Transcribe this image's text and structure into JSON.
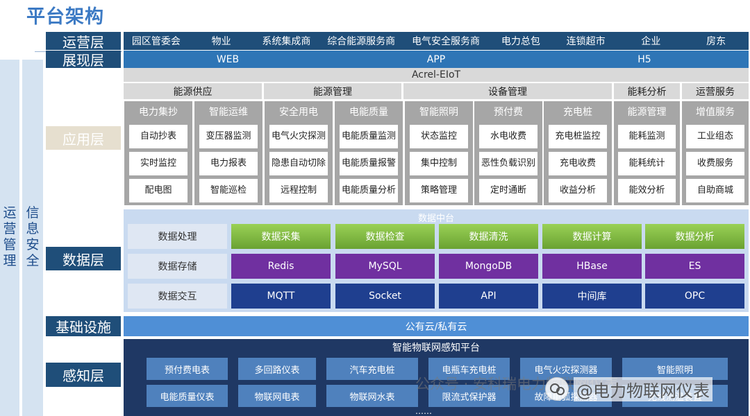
{
  "title": "平台架构",
  "side": {
    "ops_mgmt": [
      "运",
      "营",
      "管",
      "理"
    ],
    "info_sec": [
      "信",
      "息",
      "安",
      "全"
    ]
  },
  "layers": {
    "operation": "运营层",
    "presentation": "展现层",
    "application": "应用层",
    "data": "数据层",
    "infrastructure": "基础设施",
    "perception": "感知层"
  },
  "operation_items": [
    "园区管委会",
    "物业",
    "系统集成商",
    "综合能源服务商",
    "电气安全服务商",
    "电力总包",
    "连锁超市",
    "企业",
    "房东"
  ],
  "presentation_items": [
    "WEB",
    "APP",
    "H5"
  ],
  "application": {
    "platform": "Acrel-EIoT",
    "categories": [
      "能源供应",
      "能源管理",
      "设备管理",
      "能耗分析",
      "运营服务"
    ],
    "columns": [
      {
        "header": "电力集抄",
        "cells": [
          "自动抄表",
          "实时监控",
          "配电图"
        ]
      },
      {
        "header": "智能运维",
        "cells": [
          "变压器监测",
          "电力报表",
          "智能巡检"
        ]
      },
      {
        "header": "安全用电",
        "cells": [
          "电气火灾探测",
          "隐患自动切除",
          "远程控制"
        ]
      },
      {
        "header": "电能质量",
        "cells": [
          "电能质量监测",
          "电能质量报警",
          "电能质量分析"
        ]
      },
      {
        "header": "智能照明",
        "cells": [
          "状态监控",
          "集中控制",
          "策略管理"
        ]
      },
      {
        "header": "预付费",
        "cells": [
          "水电收费",
          "恶性负载识别",
          "定时通断"
        ]
      },
      {
        "header": "充电桩",
        "cells": [
          "充电桩监控",
          "充电收费",
          "收益分析"
        ]
      },
      {
        "header": "能源管理",
        "cells": [
          "能耗监测",
          "能耗统计",
          "能效分析"
        ]
      },
      {
        "header": "增值服务",
        "cells": [
          "工业组态",
          "收费服务",
          "自助商城"
        ]
      }
    ]
  },
  "data_layer": {
    "header": "数据中台",
    "rows": [
      {
        "label": "数据处理",
        "items": [
          "数据采集",
          "数据检查",
          "数据清洗",
          "数据计算",
          "数据分析"
        ]
      },
      {
        "label": "数据存储",
        "items": [
          "Redis",
          "MySQL",
          "MongoDB",
          "HBase",
          "ES"
        ]
      },
      {
        "label": "数据交互",
        "items": [
          "MQTT",
          "Socket",
          "API",
          "中间库",
          "OPC"
        ]
      }
    ]
  },
  "infrastructure_text": "公有云/私有云",
  "perception": {
    "header": "智能物联网感知平台",
    "row1": [
      "预付费电表",
      "多回路仪表",
      "汽车充电桩",
      "电瓶车充电桩",
      "电气火灾探测器",
      "智能照明"
    ],
    "row2": [
      "电能质量仪表",
      "物联网电表",
      "物联网水表",
      "限流式保护器",
      "故障电弧探测器",
      "无线测温装置"
    ],
    "ellipsis": "……"
  },
  "watermark": {
    "main": "@电力物联网仪表",
    "faded": "公众号 · 安科瑞电力物联网仪表"
  },
  "colors": {
    "navy": "#1f4e79",
    "bar_blue": "#2e75b6",
    "green": "#7ab648",
    "purple": "#7030a0",
    "dark_blue": "#1f3f8f"
  }
}
